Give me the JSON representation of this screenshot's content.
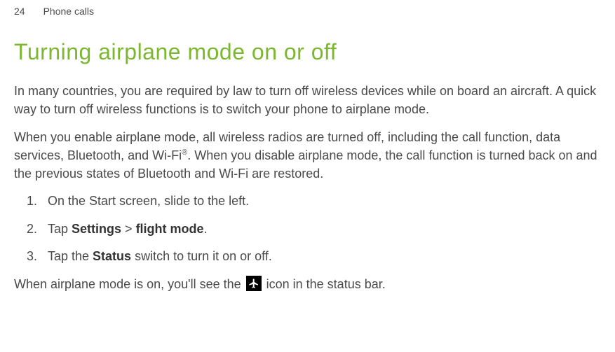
{
  "header": {
    "page_number": "24",
    "section": "Phone calls"
  },
  "title": "Turning airplane mode on or off",
  "para1": "In many countries, you are required by law to turn off wireless devices while on board an aircraft. A quick way to turn off wireless functions is to switch your phone to airplane mode.",
  "para2_before": "When you enable airplane mode, all wireless radios are turned off, including the call function, data services, Bluetooth, and Wi-Fi",
  "para2_sup": "®",
  "para2_after": ". When you disable airplane mode, the call function is turned back on and the previous states of Bluetooth and Wi-Fi are restored.",
  "steps": [
    {
      "num": "1.",
      "before": "On the Start screen, slide to the left."
    },
    {
      "num": "2.",
      "before": "Tap ",
      "bold1": "Settings",
      "mid": " > ",
      "bold2": "flight mode",
      "after": "."
    },
    {
      "num": "3.",
      "before": "Tap the ",
      "bold1": "Status",
      "after": " switch to turn it on or off."
    }
  ],
  "closing_before": "When airplane mode is on, you'll see the ",
  "closing_after": " icon in the status bar."
}
